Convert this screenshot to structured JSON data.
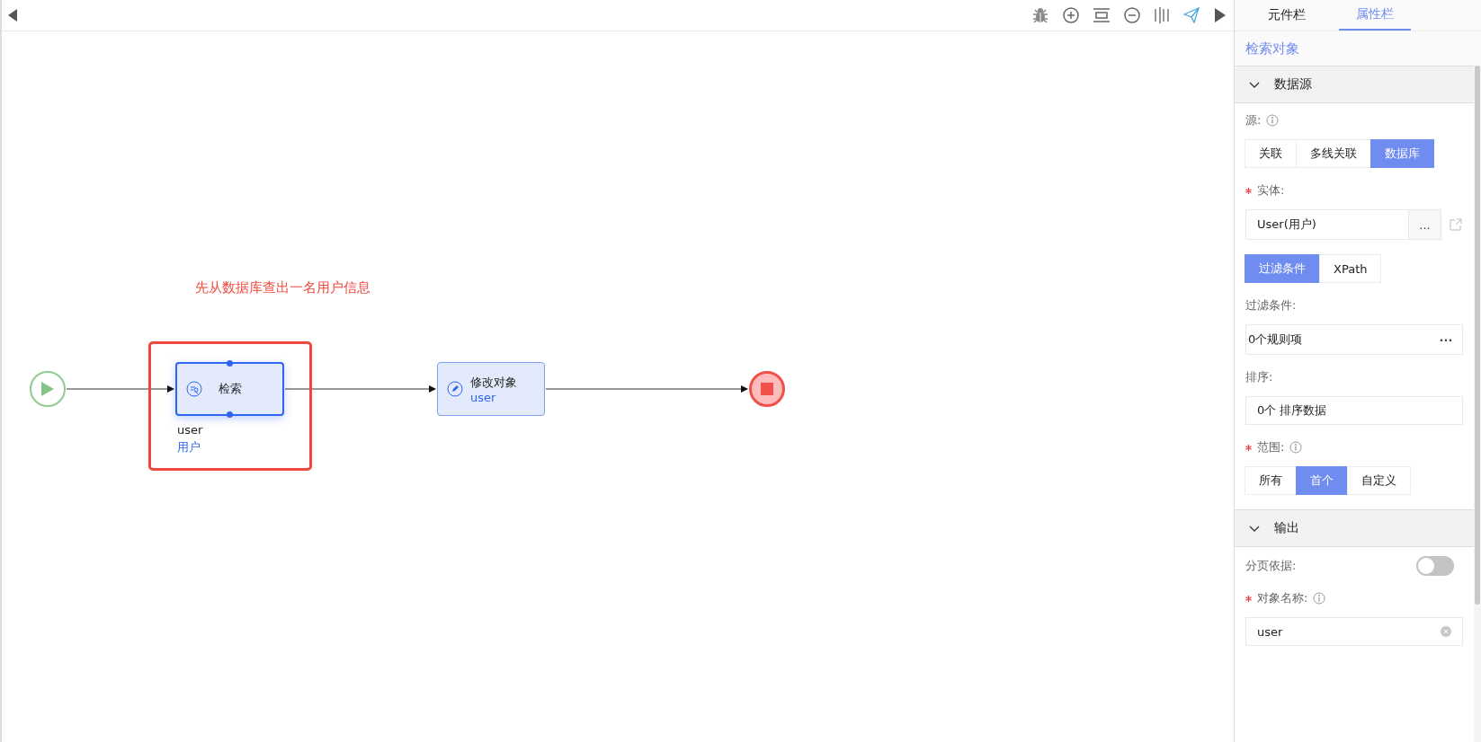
{
  "canvas": {
    "annotation": "先从数据库查出一名用户信息",
    "nodes": [
      {
        "kind": "start"
      },
      {
        "kind": "activity",
        "label": "检索",
        "selected": true,
        "caption": [
          "user",
          "用户"
        ]
      },
      {
        "kind": "activity",
        "label": "修改对象",
        "sublabel": "user",
        "selected": false
      },
      {
        "kind": "end"
      }
    ]
  },
  "panel": {
    "tabs": [
      {
        "label": "元件栏",
        "selected": false
      },
      {
        "label": "属性栏",
        "selected": true
      }
    ],
    "title": "检索对象",
    "sections": [
      {
        "title": "数据源",
        "expanded": true,
        "fields": [
          {
            "kind": "segmented",
            "label": "源:",
            "required": false,
            "info": true,
            "options": [
              {
                "label": "关联",
                "selected": false
              },
              {
                "label": "多线关联",
                "selected": false
              },
              {
                "label": "数据库",
                "selected": true
              }
            ]
          },
          {
            "kind": "picker",
            "label": "实体:",
            "required": true,
            "value": "User(用户)",
            "button": "...",
            "link": true
          },
          {
            "kind": "segmented",
            "options": [
              {
                "label": "过滤条件",
                "selected": true
              },
              {
                "label": "XPath",
                "selected": false
              }
            ]
          },
          {
            "kind": "picker",
            "label": "过滤条件:",
            "required": false,
            "value": "0个规则项",
            "button": "···"
          },
          {
            "kind": "input",
            "label": "排序:",
            "required": false,
            "value": "0个 排序数据"
          },
          {
            "kind": "segmented",
            "label": "范围:",
            "required": true,
            "info": true,
            "options": [
              {
                "label": "所有",
                "selected": false
              },
              {
                "label": "首个",
                "selected": true
              },
              {
                "label": "自定义",
                "selected": false
              }
            ]
          }
        ]
      },
      {
        "title": "输出",
        "expanded": true,
        "fields": [
          {
            "kind": "toggle",
            "label": "分页依据:",
            "required": false,
            "on": false
          },
          {
            "kind": "input",
            "label": "对象名称:",
            "required": true,
            "info": true,
            "value": "user",
            "clearable": true
          }
        ]
      }
    ]
  }
}
